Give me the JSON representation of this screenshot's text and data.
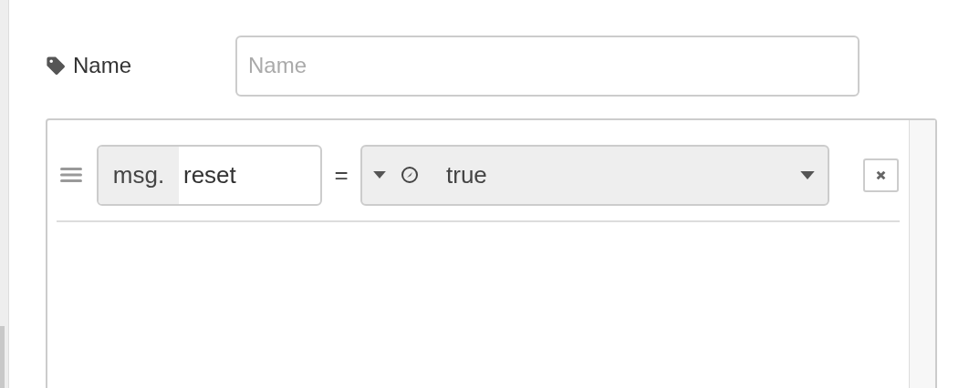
{
  "name_field": {
    "label": "Name",
    "placeholder": "Name"
  },
  "rules": [
    {
      "prefix": "msg.",
      "property": "reset",
      "operator": "=",
      "value": "true"
    }
  ]
}
